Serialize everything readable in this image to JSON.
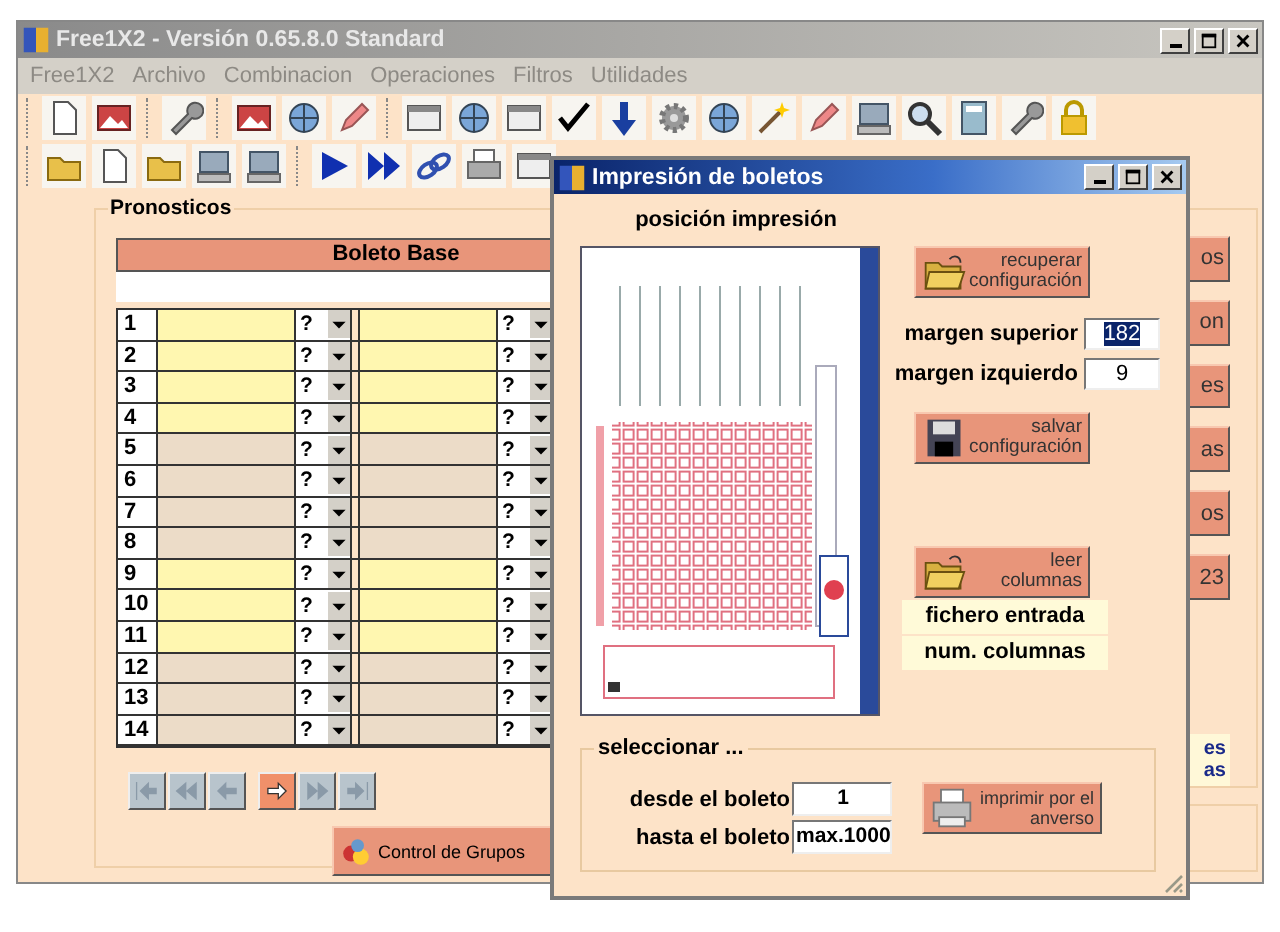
{
  "window": {
    "title": "Free1X2 - Versión 0.65.8.0 Standard"
  },
  "menu": [
    "Free1X2",
    "Archivo",
    "Combinacion",
    "Operaciones",
    "Filtros",
    "Utilidades"
  ],
  "pronosticos": {
    "title": "Pronosticos",
    "header": "Boleto Base",
    "rows": [
      {
        "number": "1",
        "highlighted": true,
        "sign_1": "?",
        "sign_2": "?"
      },
      {
        "number": "2",
        "highlighted": true,
        "sign_1": "?",
        "sign_2": "?"
      },
      {
        "number": "3",
        "highlighted": true,
        "sign_1": "?",
        "sign_2": "?"
      },
      {
        "number": "4",
        "highlighted": true,
        "sign_1": "?",
        "sign_2": "?"
      },
      {
        "number": "5",
        "highlighted": false,
        "sign_1": "?",
        "sign_2": "?"
      },
      {
        "number": "6",
        "highlighted": false,
        "sign_1": "?",
        "sign_2": "?"
      },
      {
        "number": "7",
        "highlighted": false,
        "sign_1": "?",
        "sign_2": "?"
      },
      {
        "number": "8",
        "highlighted": false,
        "sign_1": "?",
        "sign_2": "?"
      },
      {
        "number": "9",
        "highlighted": true,
        "sign_1": "?",
        "sign_2": "?"
      },
      {
        "number": "10",
        "highlighted": true,
        "sign_1": "?",
        "sign_2": "?"
      },
      {
        "number": "11",
        "highlighted": true,
        "sign_1": "?",
        "sign_2": "?"
      },
      {
        "number": "12",
        "highlighted": false,
        "sign_1": "?",
        "sign_2": "?"
      },
      {
        "number": "13",
        "highlighted": false,
        "sign_1": "?",
        "sign_2": "?"
      },
      {
        "number": "14",
        "highlighted": false,
        "sign_1": "?",
        "sign_2": "?"
      }
    ]
  },
  "navigation": [
    {
      "kind": "first",
      "disabled": true
    },
    {
      "kind": "previous-page",
      "disabled": true
    },
    {
      "kind": "previous",
      "disabled": true
    },
    {
      "kind": "next",
      "disabled": false
    },
    {
      "kind": "next-page",
      "disabled": true
    },
    {
      "kind": "last",
      "disabled": true
    }
  ],
  "group_control_button": "Control de Grupos",
  "side_buttons": [
    "os",
    "on",
    "es",
    "as",
    "os",
    "23"
  ],
  "side_label": [
    "es",
    "as"
  ],
  "dialog": {
    "title": "Impresión de boletos",
    "preview_label": "posición impresión",
    "load_button": "recuperar configuración",
    "margins": [
      {
        "label": "margen superior",
        "value": "182",
        "selected": true
      },
      {
        "label": "margen izquierdo",
        "value": "9",
        "selected": false
      }
    ],
    "save_button": "salvar configuración",
    "columns_button": "leer columnas",
    "info_boxes": [
      "fichero entrada",
      "num. columnas"
    ],
    "select_group": {
      "title": "seleccionar ...",
      "fields": [
        {
          "label": "desde el boleto",
          "value": "1"
        },
        {
          "label": "hasta el boleto",
          "value": "max.1000"
        }
      ],
      "print_button": "imprimir por el anverso"
    }
  }
}
